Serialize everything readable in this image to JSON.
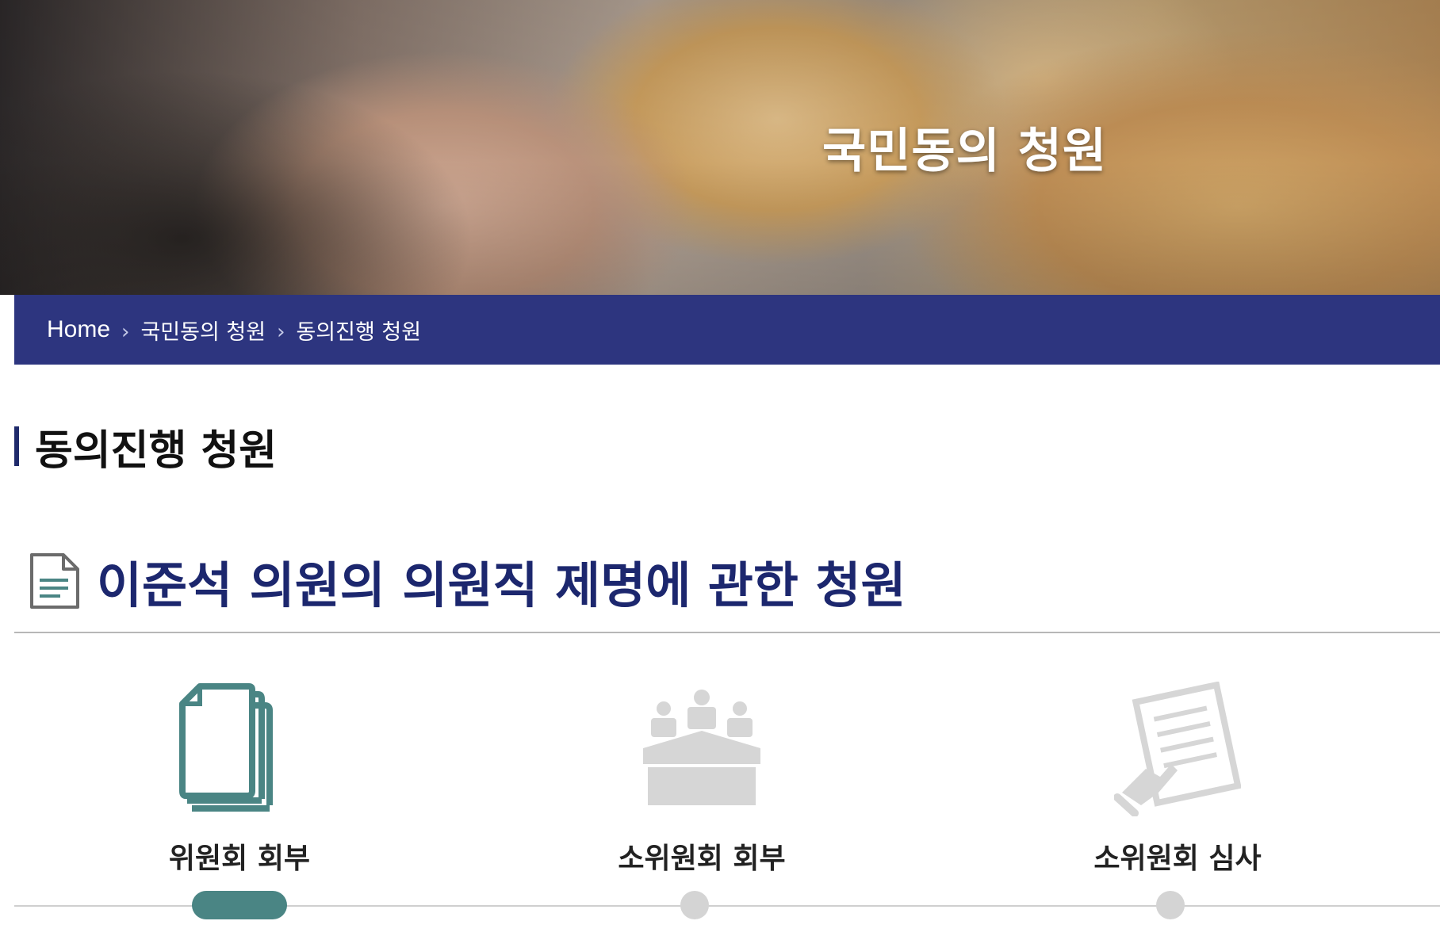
{
  "hero": {
    "title": "국민동의 청원"
  },
  "breadcrumb": {
    "items": [
      "Home",
      "국민동의 청원",
      "동의진행 청원"
    ],
    "separator": "›"
  },
  "section": {
    "title": "동의진행 청원"
  },
  "petition": {
    "title": "이준석 의원의 의원직 제명에 관한 청원",
    "icon": "document-icon"
  },
  "steps": [
    {
      "label": "위원회 회부",
      "icon": "documents-stack-icon",
      "active": true
    },
    {
      "label": "소위원회 회부",
      "icon": "meeting-table-icon",
      "active": false
    },
    {
      "label": "소위원회 심사",
      "icon": "document-review-icon",
      "active": false
    }
  ],
  "colors": {
    "accent_navy": "#1c276e",
    "breadcrumb_bar": "#242d7a",
    "active_step": "#4a8584",
    "inactive_step": "#d4d4d4"
  }
}
